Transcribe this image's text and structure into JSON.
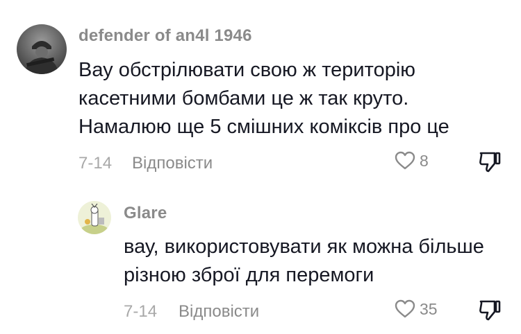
{
  "comments": [
    {
      "username": "defender of an4l 1946",
      "text": "Вау обстрілювати свою ж територію касетними бомбами це ж так круто. Намалюю ще 5 смішних коміксів про це",
      "date": "7-14",
      "reply_label": "Відповісти",
      "likes": "8",
      "avatar": "soldier-avatar-icon"
    },
    {
      "username": "Glare",
      "text": "вау, використовувати як можна більше різною зброї для перемоги",
      "date": "7-14",
      "reply_label": "Відповісти",
      "likes": "35",
      "avatar": "cartoon-avatar-icon"
    }
  ],
  "icons": {
    "like": "heart-outline-icon",
    "dislike": "thumbs-down-icon"
  },
  "colors": {
    "text": "#161823",
    "muted": "#8a8a8a"
  }
}
